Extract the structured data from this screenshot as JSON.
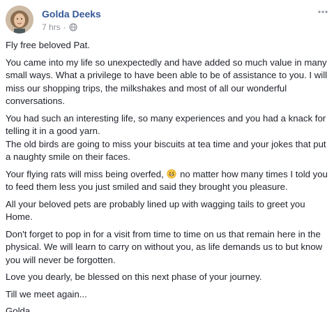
{
  "post": {
    "author": "Golda Deeks",
    "timestamp": "7 hrs",
    "separator": "·",
    "privacy_icon": "globe-icon",
    "menu_icon": "more-options-icon",
    "avatar_icon": "profile-photo",
    "paragraphs": [
      "Fly free beloved Pat.",
      "You came into my life so unexpectedly and have added so much value in many small ways. What a privilege to have been able to be of assistance to you. I will miss our shopping trips, the milkshakes and most of all our wonderful conversations.",
      "You had such an interesting life, so many experiences and you had a knack for telling it in a good yarn.\nThe old birds are going to miss your biscuits at tea time and your jokes that put a naughty smile on their faces.",
      "All your beloved pets are probably lined up with wagging tails to greet you Home.",
      "Don't forget to pop in for a visit from time to time on us that remain here in the physical. We will learn to carry on without you, as life demands us to but know you will never be forgotten.",
      "Love you dearly, be blessed on this next phase of your journey.",
      "Till we meet again...",
      "Golda"
    ],
    "emoji_paragraph": {
      "before": "Your flying rats will miss being overfed, ",
      "emoji_icon": "grinning-face-emoji",
      "after": " no matter how many times I told you to feed them less you just smiled and said they brought you pleasure."
    },
    "colors": {
      "name": "#365899",
      "meta": "#90949c",
      "text": "#1d2129"
    }
  }
}
